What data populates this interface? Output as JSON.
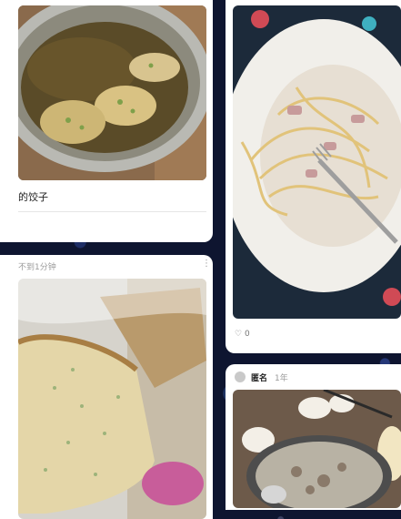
{
  "feed": {
    "card_dumplings": {
      "title": "的饺子",
      "image_icon": "pan-with-pan-fried-dumplings"
    },
    "card_bread": {
      "meta": "不到1分钟",
      "more_icon": "kebab-menu-icon",
      "image_icon": "bread-in-bag"
    },
    "card_pasta": {
      "likes": "0",
      "heart_icon": "heart-outline-icon",
      "image_icon": "plate-of-carbonara-pasta"
    },
    "card_hotpot": {
      "author": "匿名",
      "time": "1年",
      "avatar_icon": "anonymous-avatar-icon",
      "image_icon": "hotpot-on-table"
    }
  },
  "colors": {
    "background": "#0e1530",
    "card": "#ffffff",
    "meta_text": "#9a9a9a"
  }
}
